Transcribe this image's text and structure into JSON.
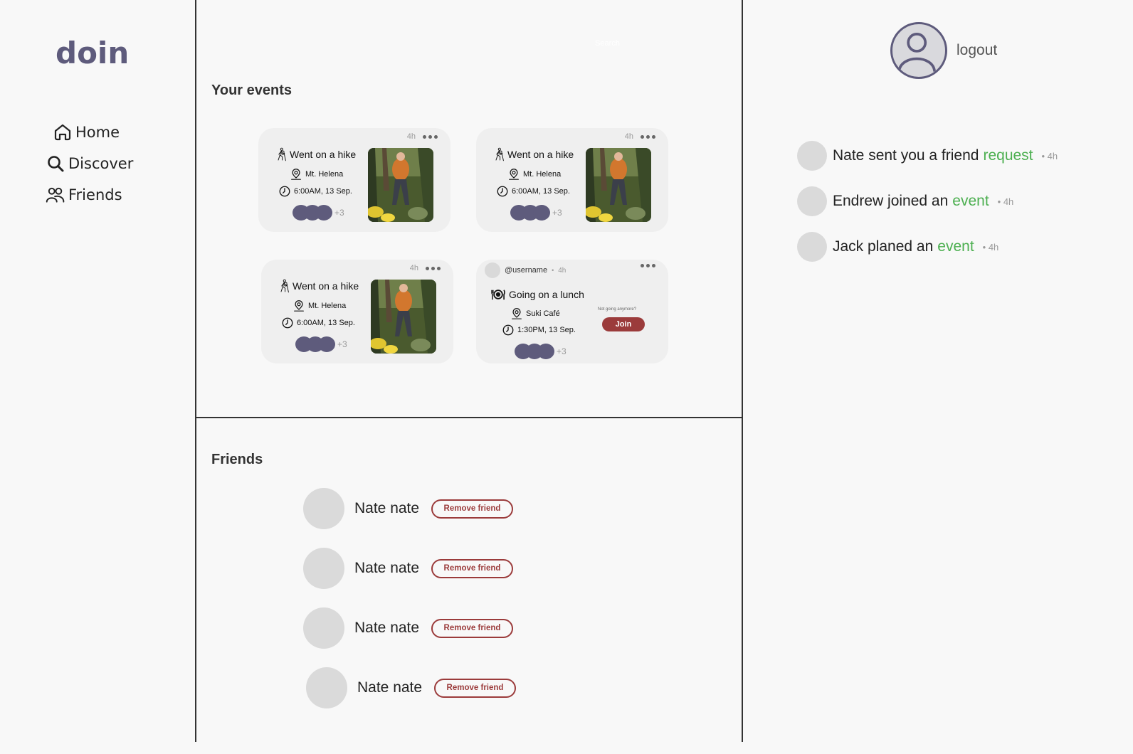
{
  "app": {
    "logo": "doin"
  },
  "nav": [
    {
      "label": "Home",
      "icon": "home-icon"
    },
    {
      "label": "Discover",
      "icon": "search-icon"
    },
    {
      "label": "Friends",
      "icon": "friends-icon"
    }
  ],
  "search_hint": "Search",
  "events_section": {
    "title": "Your events"
  },
  "events": [
    {
      "title": "Went on a hike",
      "location": "Mt. Helena",
      "time": "6:00AM, 13 Sep.",
      "age": "4h",
      "more": "+3"
    },
    {
      "title": "Went on a hike",
      "location": "Mt. Helena",
      "time": "6:00AM, 13 Sep.",
      "age": "4h",
      "more": "+3"
    },
    {
      "title": "Went on a hike",
      "location": "Mt. Helena",
      "time": "6:00AM, 13 Sep.",
      "age": "4h",
      "more": "+3"
    }
  ],
  "lunch": {
    "username": "@username",
    "separator": "•",
    "age": "4h",
    "title": "Going on a lunch",
    "location": "Suki Café",
    "time": "1:30PM, 13 Sep.",
    "not_going": "Not going anymore?",
    "join_label": "Join",
    "more": "+3"
  },
  "friends_section": {
    "title": "Friends"
  },
  "friends": [
    {
      "name": "Nate nate",
      "action": "Remove friend"
    },
    {
      "name": "Nate nate",
      "action": "Remove friend"
    },
    {
      "name": "Nate nate",
      "action": "Remove friend"
    },
    {
      "name": "Nate nate",
      "action": "Remove friend"
    }
  ],
  "profile": {
    "logout_label": "logout"
  },
  "notifications": [
    {
      "text": "Nate sent you a friend",
      "link": "request",
      "age": "• 4h"
    },
    {
      "text": "Endrew joined an",
      "link": "event",
      "age": "• 4h"
    },
    {
      "text": "Jack planed an",
      "link": "event",
      "age": "• 4h"
    }
  ],
  "colors": {
    "brand": "#5e5b7c",
    "accent_green": "#4caf50",
    "danger": "#9b3b3b"
  }
}
